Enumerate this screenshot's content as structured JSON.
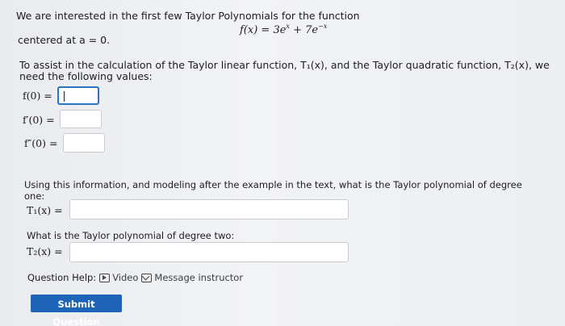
{
  "intro": "We are interested in the first few Taylor Polynomials for the function",
  "function": {
    "lhs": "f(x) = 3e",
    "exp1": "x",
    "mid": " + 7e",
    "exp2": "−x"
  },
  "centered": "centered at a = 0.",
  "assist_line1": "To assist in the calculation of the Taylor linear function, T₁(x), and the Taylor quadratic function, T₂(x), we",
  "assist_line2": "need the following values:",
  "values": [
    {
      "label": "f(0) =",
      "value": ""
    },
    {
      "label": "f′(0) =",
      "value": ""
    },
    {
      "label": "f″(0) =",
      "value": ""
    }
  ],
  "question1_line1": "Using this information, and modeling after the example in the text, what is the Taylor polynomial of degree",
  "question1_line2": "one:",
  "t1_label": "T₁(x) =",
  "t1_value": "",
  "question2": "What is the Taylor polynomial of degree two:",
  "t2_label": "T₂(x) =",
  "t2_value": "",
  "help": {
    "label": "Question Help:",
    "video": "Video",
    "message": "Message instructor"
  },
  "submit_label": "Submit Question"
}
